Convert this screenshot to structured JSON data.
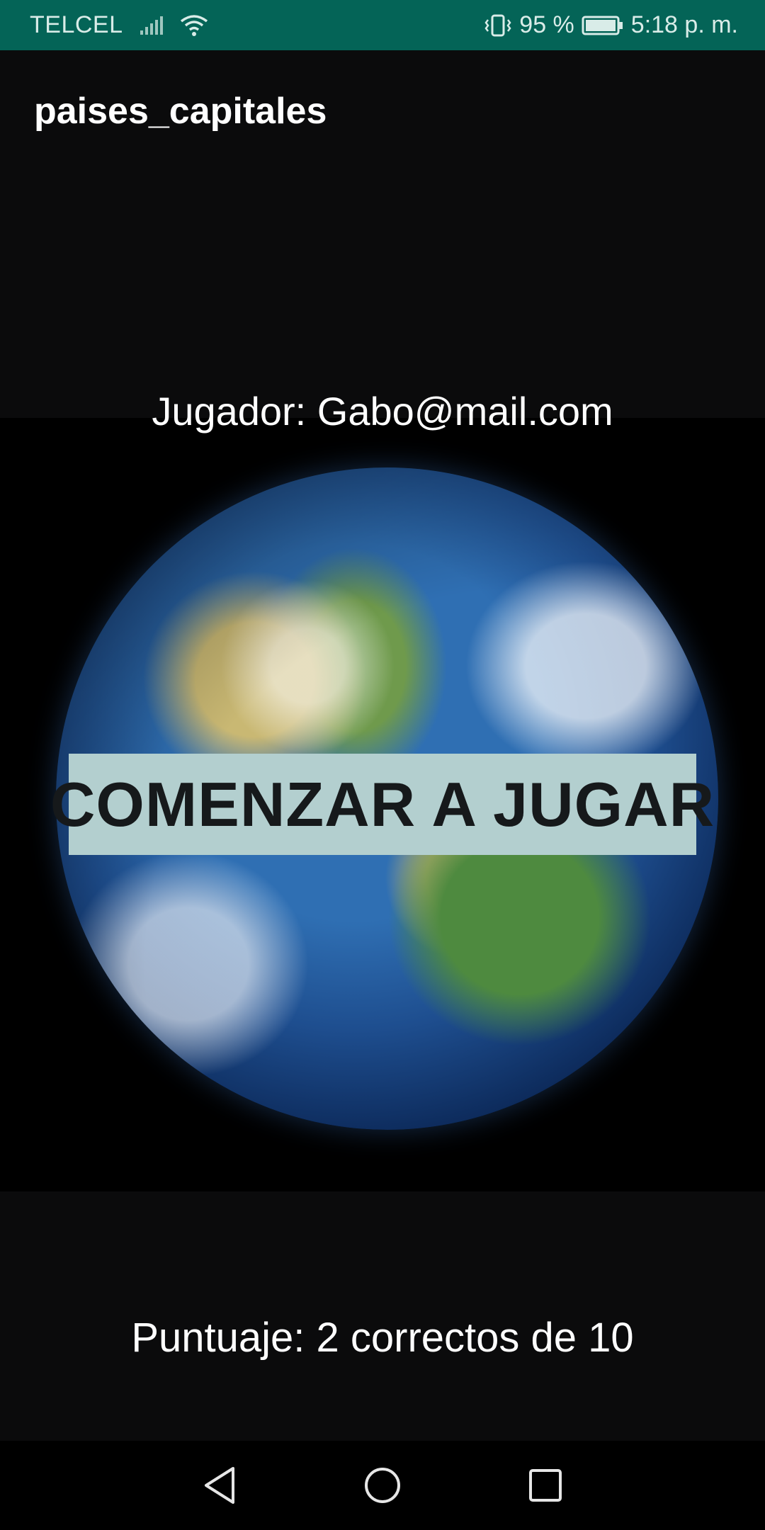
{
  "status_bar": {
    "carrier": "TELCEL",
    "battery_percent": "95 %",
    "time": "5:18 p. m.",
    "icons": [
      "signal-icon",
      "wifi-icon",
      "vibrate-icon",
      "battery-icon"
    ]
  },
  "app_bar": {
    "title": "paises_capitales"
  },
  "main": {
    "player_label": "Jugador: Gabo@mail.com",
    "start_button_label": "COMENZAR A JUGAR",
    "score_label": "Puntuaje: 2 correctos de 10",
    "hero_image": "earth-globe"
  },
  "nav_bar": {
    "icons": [
      "back-icon",
      "home-icon",
      "recents-icon"
    ]
  },
  "colors": {
    "status_bar": "#046457",
    "background": "#0b0b0c",
    "button_background": "#b3cfcf",
    "button_text": "#16191b"
  }
}
